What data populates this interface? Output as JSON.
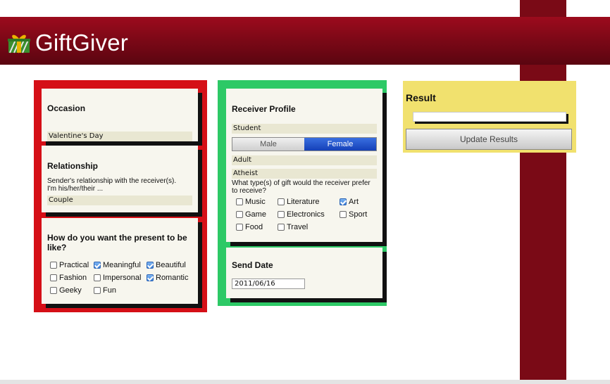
{
  "app": {
    "title": "GiftGiver",
    "icon": "gift-icon"
  },
  "colors": {
    "ribbon": "#8a0a18",
    "red_panel": "#d50f17",
    "green_panel": "#2dc966",
    "yellow_panel": "#f1e16e",
    "card": "#f7f6ee"
  },
  "occasion": {
    "title": "Occasion",
    "value": "Valentine's Day"
  },
  "relationship": {
    "title": "Relationship",
    "desc_line1": "Sender's relationship with the receiver(s).",
    "desc_line2": "I'm his/her/their ...",
    "value": "Couple"
  },
  "present": {
    "title_line1": "How do you want the present to be",
    "title_line2": "like?",
    "options": [
      {
        "label": "Practical",
        "checked": false
      },
      {
        "label": "Meaningful",
        "checked": true
      },
      {
        "label": "Beautiful",
        "checked": true
      },
      {
        "label": "Fashion",
        "checked": false
      },
      {
        "label": "Impersonal",
        "checked": false
      },
      {
        "label": "Romantic",
        "checked": true
      },
      {
        "label": "Geeky",
        "checked": false
      },
      {
        "label": "Fun",
        "checked": false
      }
    ]
  },
  "receiver": {
    "title": "Receiver Profile",
    "occupation": "Student",
    "gender": {
      "male": "Male",
      "female": "Female",
      "selected": "Female"
    },
    "age": "Adult",
    "religion": "Atheist",
    "question_line1": "What type(s) of gift would the receiver prefer",
    "question_line2": "to receive?",
    "types": [
      {
        "label": "Music",
        "checked": false
      },
      {
        "label": "Literature",
        "checked": false
      },
      {
        "label": "Art",
        "checked": true
      },
      {
        "label": "Game",
        "checked": false
      },
      {
        "label": "Electronics",
        "checked": false
      },
      {
        "label": "Sport",
        "checked": false
      },
      {
        "label": "Food",
        "checked": false
      },
      {
        "label": "Travel",
        "checked": false
      }
    ]
  },
  "send_date": {
    "title": "Send Date",
    "value": "2011/06/16"
  },
  "result": {
    "title": "Result",
    "button": "Update Results"
  }
}
